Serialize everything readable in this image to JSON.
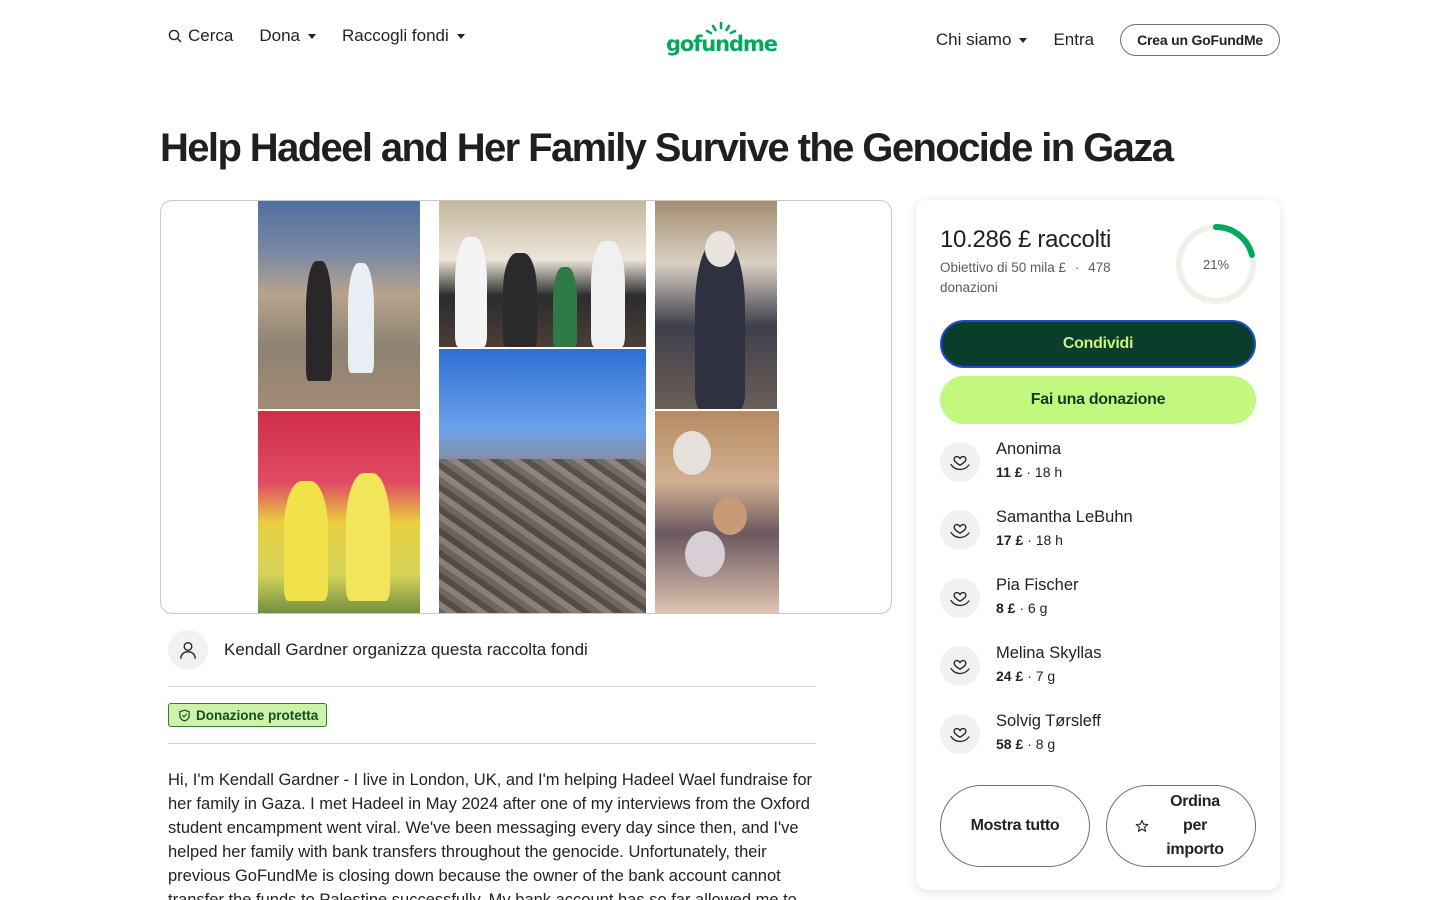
{
  "header": {
    "search_label": "Cerca",
    "donate_label": "Dona",
    "fundraise_label": "Raccogli fondi",
    "logo_text": "gofundme",
    "about_label": "Chi siamo",
    "signin_label": "Entra",
    "create_label": "Crea un GoFundMe"
  },
  "campaign": {
    "title": "Help Hadeel and Her Family Survive the Genocide in Gaza",
    "organizer_text": "Kendall Gardner organizza questa raccolta fondi",
    "protected_label": "Donazione protetta",
    "description": "Hi, I'm Kendall Gardner - I live in London, UK, and I'm helping Hadeel Wael fundraise for her family in Gaza. I met Hadeel in May 2024 after one of my interviews from the Oxford student encampment went viral. We've been messaging every day since then, and I've helped her family with bank transfers throughout the genocide. Unfortunately, their previous GoFundMe is closing down because the owner of the bank account cannot transfer the funds to Palestine successfully. My bank account has so far allowed me to"
  },
  "progress": {
    "raised_text": "10.286 £ raccolti",
    "goal_text": "Obiettivo di 50 mila £",
    "separator": "·",
    "donations_text": "478 donazioni",
    "percent_label": "21%",
    "percent_value": 0.21,
    "ring_color": "#02a95c",
    "track_color": "#eef1e8"
  },
  "actions": {
    "share_label": "Condividi",
    "donate_label": "Fai una donazione"
  },
  "donations": [
    {
      "name": "Anonima",
      "amount": "11 £",
      "time": "· 18 h"
    },
    {
      "name": "Samantha LeBuhn",
      "amount": "17 £",
      "time": "· 18 h"
    },
    {
      "name": "Pia Fischer",
      "amount": "8 £",
      "time": "· 6 g"
    },
    {
      "name": "Melina Skyllas",
      "amount": "24 £",
      "time": "· 7 g"
    },
    {
      "name": "Solvig Tørsleff",
      "amount": "58 £",
      "time": "· 8 g"
    }
  ],
  "list_actions": {
    "show_all_label": "Mostra tutto",
    "sort_label": "Ordina per importo"
  },
  "colors": {
    "brand_green": "#02a95c",
    "share_bg": "#0b3d2c",
    "donate_bg": "#c3f87f"
  }
}
